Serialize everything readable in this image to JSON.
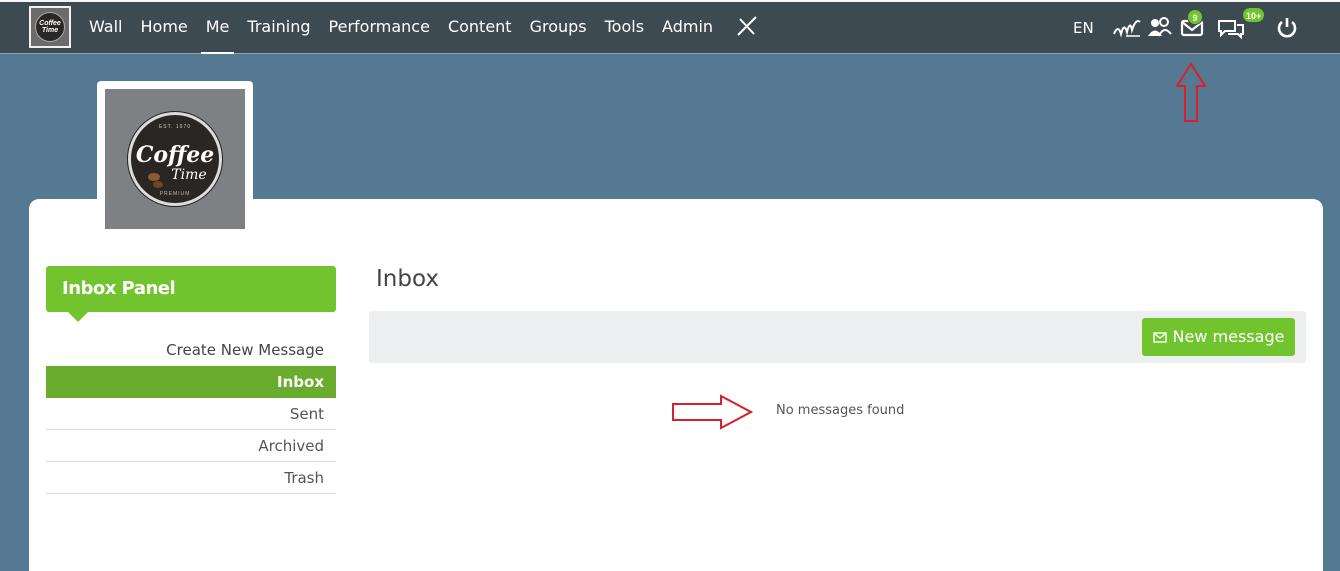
{
  "nav": {
    "logo_text": "Coffee Time",
    "items": [
      {
        "label": "Wall"
      },
      {
        "label": "Home"
      },
      {
        "label": "Me",
        "active": true
      },
      {
        "label": "Training"
      },
      {
        "label": "Performance"
      },
      {
        "label": "Content"
      },
      {
        "label": "Groups"
      },
      {
        "label": "Tools"
      },
      {
        "label": "Admin"
      }
    ],
    "language": "EN",
    "icons": [
      "signature-icon",
      "users-icon",
      "mail-icon",
      "chat-icon",
      "power-icon"
    ],
    "mail_badge": "9",
    "chat_badge": "10+"
  },
  "profile": {
    "badge_est": "EST. 1970",
    "badge_word1": "Coffee",
    "badge_word2": "Time",
    "badge_premium": "PREMIUM"
  },
  "sidebar": {
    "title": "Inbox Panel",
    "items": [
      {
        "label": "Create New Message"
      },
      {
        "label": "Inbox",
        "active": true
      },
      {
        "label": "Sent"
      },
      {
        "label": "Archived"
      },
      {
        "label": "Trash"
      }
    ]
  },
  "main": {
    "title": "Inbox",
    "new_message_label": "New message",
    "empty_text": "No messages found"
  },
  "colors": {
    "accent_green": "#72c42f",
    "topbar": "#3e4a52",
    "background": "#557893",
    "annotation_red": "#d9202a"
  }
}
